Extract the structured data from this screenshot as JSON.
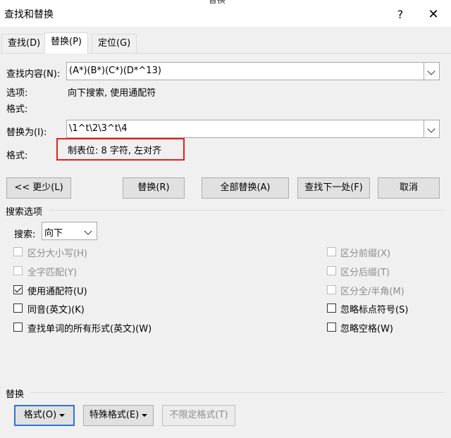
{
  "window": {
    "partial_top_text": "替换",
    "title": "查找和替换",
    "help_symbol": "?",
    "close_symbol": "✕"
  },
  "tabs": [
    {
      "label": "查找(D)",
      "active": false
    },
    {
      "label": "替换(P)",
      "active": true
    },
    {
      "label": "定位(G)",
      "active": false
    }
  ],
  "find": {
    "label": "查找内容(N):",
    "value": "(A*)(B*)(C*)(D*^13)",
    "options_label": "选项:",
    "options_value": "向下搜索, 使用通配符",
    "format_label": "格式:",
    "format_value": ""
  },
  "replace": {
    "label": "替换为(I):",
    "value": "\\1^t\\2\\3^t\\4",
    "format_label": "格式:",
    "format_value": "制表位:  8 字符, 左对齐"
  },
  "buttons": {
    "less": "<< 更少(L)",
    "replace": "替换(R)",
    "replace_all": "全部替换(A)",
    "find_next": "查找下一处(F)",
    "cancel": "取消"
  },
  "search_options": {
    "title": "搜索选项",
    "search_label": "搜索:",
    "search_value": "向下",
    "left": [
      {
        "label": "区分大小写(H)",
        "checked": false,
        "disabled": true
      },
      {
        "label": "全字匹配(Y)",
        "checked": false,
        "disabled": true
      },
      {
        "label": "使用通配符(U)",
        "checked": true,
        "disabled": false
      },
      {
        "label": "同音(英文)(K)",
        "checked": false,
        "disabled": false
      },
      {
        "label": "查找单词的所有形式(英文)(W)",
        "checked": false,
        "disabled": false
      }
    ],
    "right": [
      {
        "label": "区分前缀(X)",
        "checked": false,
        "disabled": true
      },
      {
        "label": "区分后缀(T)",
        "checked": false,
        "disabled": true
      },
      {
        "label": "区分全/半角(M)",
        "checked": false,
        "disabled": true
      },
      {
        "label": "忽略标点符号(S)",
        "checked": false,
        "disabled": false
      },
      {
        "label": "忽略空格(W)",
        "checked": false,
        "disabled": false
      }
    ]
  },
  "replace_section": {
    "title": "替换",
    "format_btn": "格式(O)",
    "special_btn": "特殊格式(E)",
    "no_format_btn": "不限定格式(T)"
  },
  "colors": {
    "highlight_box": "#e02020",
    "focus_border": "#2d74d4"
  }
}
